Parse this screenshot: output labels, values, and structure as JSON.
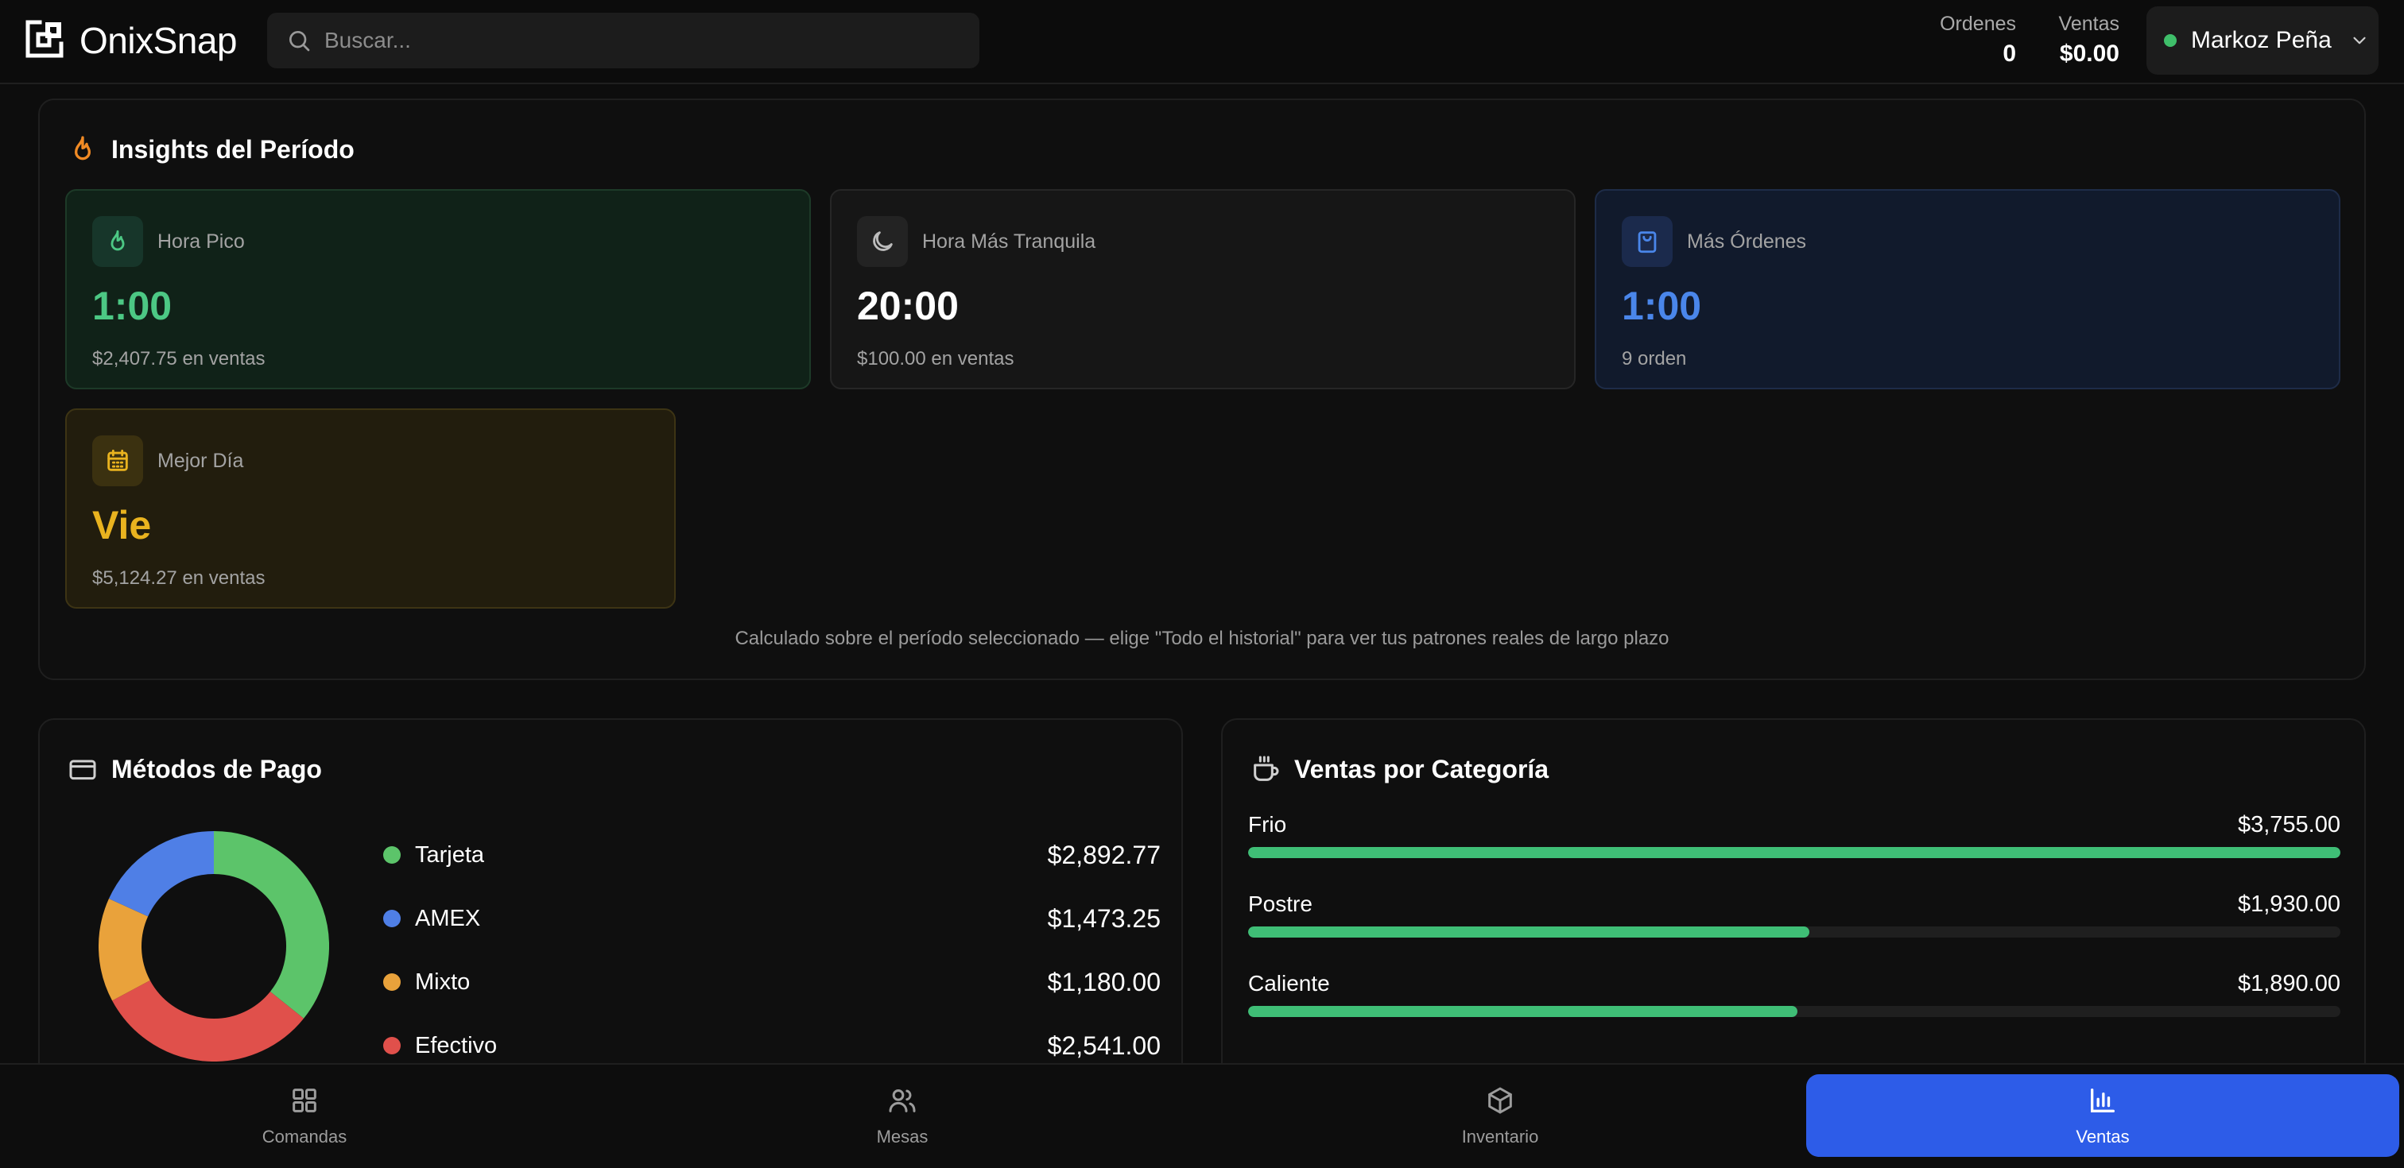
{
  "app": {
    "name": "OnixSnap"
  },
  "search": {
    "placeholder": "Buscar..."
  },
  "header_stats": {
    "orders_label": "Ordenes",
    "orders_value": "0",
    "sales_label": "Ventas",
    "sales_value": "$0.00"
  },
  "user": {
    "name": "Markoz Peña",
    "status_color": "#3fbf6a"
  },
  "insights": {
    "title": "Insights del Período",
    "tiles": [
      {
        "label": "Hora Pico",
        "value": "1:00",
        "sub": "$2,407.75 en ventas",
        "icon": "flame-icon",
        "accent": "#4cc884"
      },
      {
        "label": "Hora Más Tranquila",
        "value": "20:00",
        "sub": "$100.00 en ventas",
        "icon": "moon-icon",
        "accent": "#ffffff"
      },
      {
        "label": "Más Órdenes",
        "value": "1:00",
        "sub": "9 orden",
        "icon": "shopping-bag-icon",
        "accent": "#4a86ea"
      },
      {
        "label": "Mejor Día",
        "value": "Vie",
        "sub": "$5,124.27 en ventas",
        "icon": "calendar-icon",
        "accent": "#e9b31f"
      }
    ],
    "note": "Calculado sobre el período seleccionado — elige \"Todo el historial\" para ver tus patrones reales de largo plazo"
  },
  "payments": {
    "title": "Métodos de Pago",
    "icon": "credit-card-icon",
    "methods": [
      {
        "name": "Tarjeta",
        "value": "$2,892.77",
        "amount": 2892.77,
        "color": "#5cc46a"
      },
      {
        "name": "AMEX",
        "value": "$1,473.25",
        "amount": 1473.25,
        "color": "#4f7fe6"
      },
      {
        "name": "Mixto",
        "value": "$1,180.00",
        "amount": 1180.0,
        "color": "#e9a23b"
      },
      {
        "name": "Efectivo",
        "value": "$2,541.00",
        "amount": 2541.0,
        "color": "#e0504b"
      }
    ]
  },
  "categories": {
    "title": "Ventas por Categoría",
    "icon": "coffee-cup-icon",
    "items": [
      {
        "name": "Frio",
        "value": "$3,755.00",
        "fraction": 1.0
      },
      {
        "name": "Postre",
        "value": "$1,930.00",
        "fraction": 0.514
      },
      {
        "name": "Caliente",
        "value": "$1,890.00",
        "fraction": 0.503
      }
    ]
  },
  "nav": {
    "items": [
      {
        "label": "Comandas",
        "icon": "grid-icon"
      },
      {
        "label": "Mesas",
        "icon": "users-icon"
      },
      {
        "label": "Inventario",
        "icon": "box-icon"
      },
      {
        "label": "Ventas",
        "icon": "bar-chart-icon",
        "active": true
      }
    ]
  },
  "colors": {
    "accent_blue": "#2d5ce8",
    "bar_green": "#3fbe76"
  }
}
